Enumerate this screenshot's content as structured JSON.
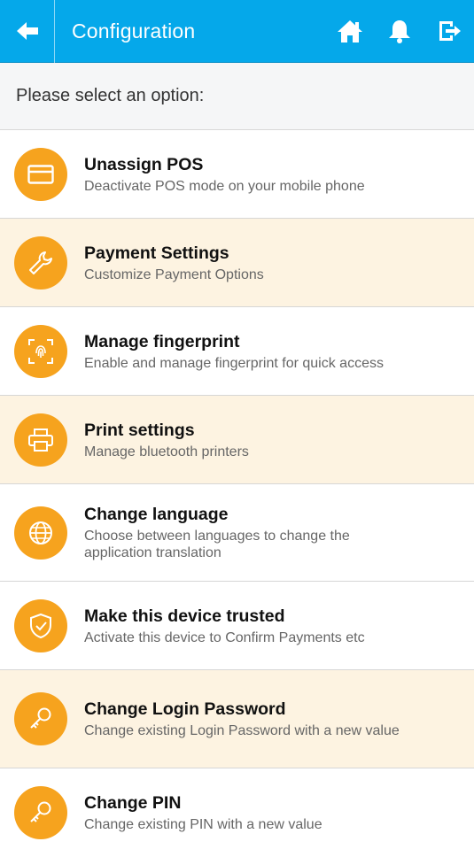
{
  "header": {
    "title": "Configuration",
    "back_icon": "arrow-left-icon",
    "home_icon": "home-icon",
    "bell_icon": "bell-icon",
    "logout_icon": "logout-icon"
  },
  "prompt": "Please select an option:",
  "colors": {
    "topbar": "#05a8ea",
    "accent": "#f6a31e",
    "alt_row": "#fdf3e1"
  },
  "options": [
    {
      "title": "Unassign POS",
      "subtitle": "Deactivate POS mode on your mobile phone",
      "icon": "card-icon"
    },
    {
      "title": "Payment Settings",
      "subtitle": "Customize Payment Options",
      "icon": "wrench-icon"
    },
    {
      "title": "Manage fingerprint",
      "subtitle": "Enable and manage fingerprint for quick access",
      "icon": "fingerprint-icon"
    },
    {
      "title": "Print settings",
      "subtitle": "Manage bluetooth printers",
      "icon": "printer-icon"
    },
    {
      "title": "Change language",
      "subtitle": "Choose between languages to change the application translation",
      "icon": "globe-icon"
    },
    {
      "title": "Make this device trusted",
      "subtitle": "Activate this device to Confirm Payments etc",
      "icon": "shield-check-icon"
    },
    {
      "title": "Change Login Password",
      "subtitle": "Change existing Login Password with a new value",
      "icon": "key-icon"
    },
    {
      "title": "Change PIN",
      "subtitle": "Change existing PIN with a new value",
      "icon": "key-icon"
    }
  ]
}
